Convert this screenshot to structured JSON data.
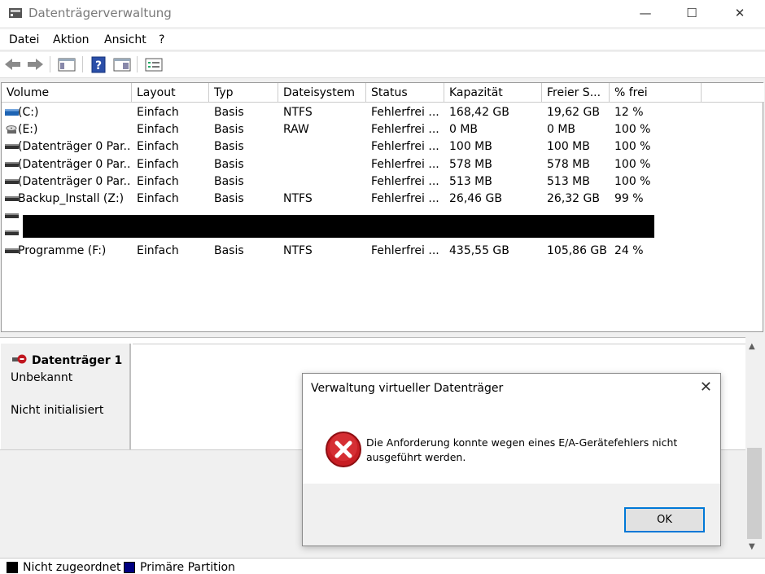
{
  "window": {
    "title": "Datenträgerverwaltung",
    "minimize": "—",
    "maximize": "☐",
    "close": "✕"
  },
  "menu": [
    "Datei",
    "Aktion",
    "Ansicht",
    "?"
  ],
  "columns": [
    "Volume",
    "Layout",
    "Typ",
    "Dateisystem",
    "Status",
    "Kapazität",
    "Freier S...",
    "% frei"
  ],
  "volumes": [
    {
      "icon": "drive-blue-icon",
      "name": "(C:)",
      "layout": "Einfach",
      "type": "Basis",
      "fs": "NTFS",
      "status": "Fehlerfrei ...",
      "capacity": "168,42 GB",
      "free": "19,62 GB",
      "pct": "12 %"
    },
    {
      "icon": "cd-drive-icon",
      "name": "(E:)",
      "layout": "Einfach",
      "type": "Basis",
      "fs": "RAW",
      "status": "Fehlerfrei ...",
      "capacity": "0 MB",
      "free": "0 MB",
      "pct": "100 %"
    },
    {
      "icon": "drive-icon",
      "name": "(Datenträger 0 Par...",
      "layout": "Einfach",
      "type": "Basis",
      "fs": "",
      "status": "Fehlerfrei ...",
      "capacity": "100 MB",
      "free": "100 MB",
      "pct": "100 %"
    },
    {
      "icon": "drive-icon",
      "name": "(Datenträger 0 Par...",
      "layout": "Einfach",
      "type": "Basis",
      "fs": "",
      "status": "Fehlerfrei ...",
      "capacity": "578 MB",
      "free": "578 MB",
      "pct": "100 %"
    },
    {
      "icon": "drive-icon",
      "name": "(Datenträger 0 Par...",
      "layout": "Einfach",
      "type": "Basis",
      "fs": "",
      "status": "Fehlerfrei ...",
      "capacity": "513 MB",
      "free": "513 MB",
      "pct": "100 %"
    },
    {
      "icon": "drive-icon",
      "name": "Backup_Install (Z:)",
      "layout": "Einfach",
      "type": "Basis",
      "fs": "NTFS",
      "status": "Fehlerfrei ...",
      "capacity": "26,46 GB",
      "free": "26,32 GB",
      "pct": "99 %"
    },
    {
      "icon": "drive-icon",
      "name": "",
      "layout": "",
      "type": "",
      "fs": "",
      "status": "",
      "capacity": "",
      "free": "",
      "pct": ""
    },
    {
      "icon": "drive-icon",
      "name": "",
      "layout": "",
      "type": "",
      "fs": "",
      "status": "",
      "capacity": "",
      "free": "",
      "pct": ""
    },
    {
      "icon": "drive-icon",
      "name": "Programme (F:)",
      "layout": "Einfach",
      "type": "Basis",
      "fs": "NTFS",
      "status": "Fehlerfrei ...",
      "capacity": "435,55 GB",
      "free": "105,86 GB",
      "pct": "24 %"
    }
  ],
  "disk": {
    "name": "Datenträger 1",
    "type": "Unbekannt",
    "state": "Nicht initialisiert"
  },
  "legend": [
    {
      "label": "Nicht zugeordnet",
      "color": "#000000"
    },
    {
      "label": "Primäre Partition",
      "color": "#000080"
    }
  ],
  "dialog": {
    "title": "Verwaltung virtueller Datenträger",
    "message": "Die Anforderung konnte wegen eines E/A-Gerätefehlers nicht ausgeführt werden.",
    "ok": "OK"
  }
}
